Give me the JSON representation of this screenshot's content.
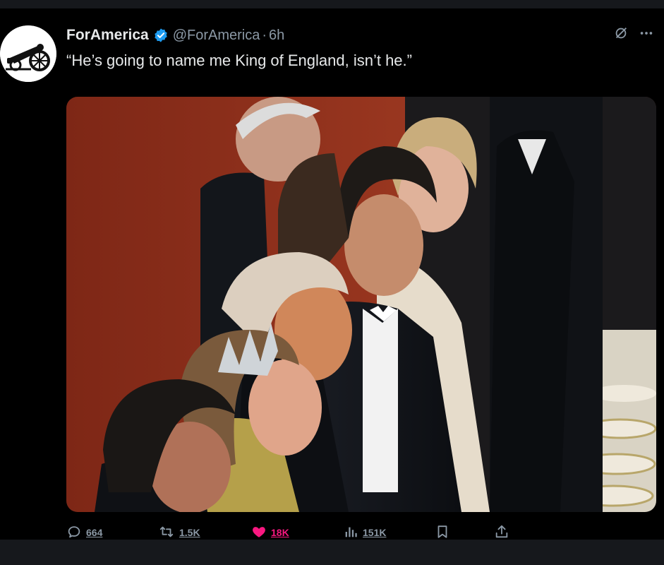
{
  "tweet": {
    "display_name": "ForAmerica",
    "handle": "@ForAmerica",
    "separator": "·",
    "time": "6h",
    "text": "“He’s going to name me King of England, isn’t he.”"
  },
  "actions": {
    "replies": "664",
    "retweets": "1.5K",
    "likes": "18K",
    "views": "151K"
  },
  "icons": {
    "avatar": "cannon-logo",
    "verified": "verified-badge-icon",
    "grok": "grok-icon",
    "more": "more-icon",
    "reply": "reply-icon",
    "retweet": "retweet-icon",
    "like": "heart-icon",
    "views": "views-icon",
    "bookmark": "bookmark-icon",
    "share": "share-icon"
  },
  "colors": {
    "background": "#000000",
    "text": "#e7e9ea",
    "muted": "#8b98a5",
    "verified": "#1d9bf0",
    "like": "#f91880"
  }
}
